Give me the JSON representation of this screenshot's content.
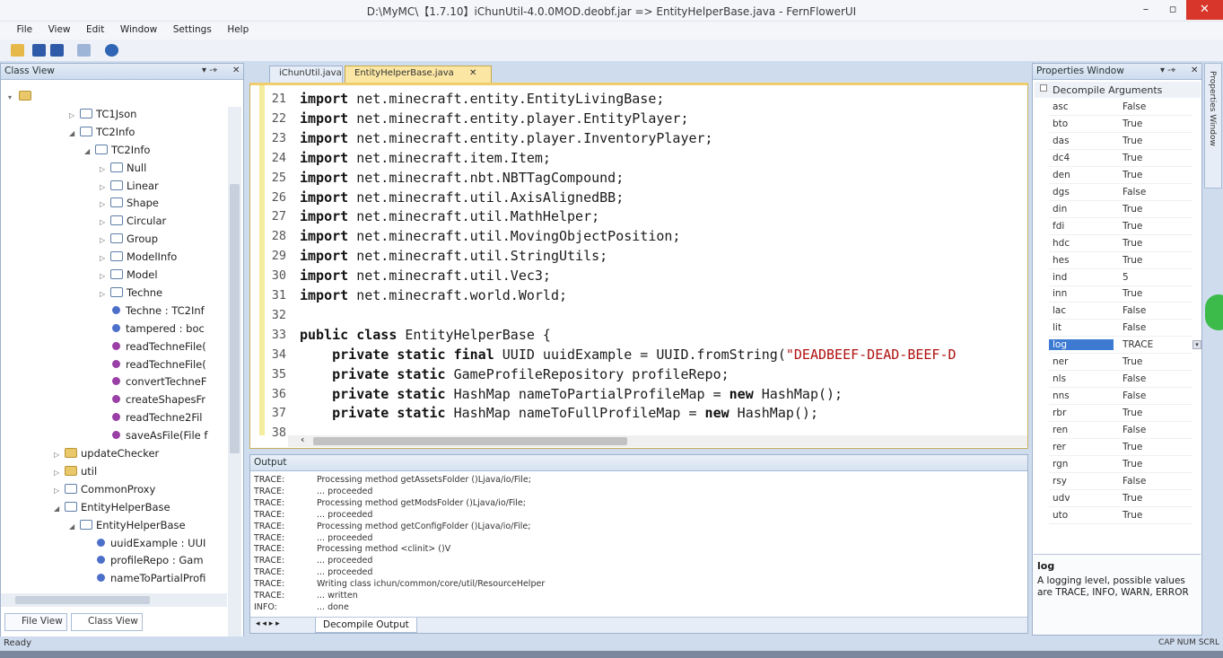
{
  "window": {
    "title": "D:\\MyMC\\【1.7.10】iChunUtil-4.0.0MOD.deobf.jar => EntityHelperBase.java - FernFlowerUI",
    "minimize": "–",
    "maximize": "▫",
    "close": "✕"
  },
  "menu": [
    "File",
    "View",
    "Edit",
    "Window",
    "Settings",
    "Help"
  ],
  "class_view": {
    "title": "Class View",
    "pin": "▾ ‑⌖",
    "close": "✕",
    "tree": [
      {
        "label": "",
        "kind": "pkg",
        "depth": 0,
        "expander": "▾"
      },
      {
        "label": "TC1Json",
        "kind": "cls",
        "depth": 4,
        "expander": "▷"
      },
      {
        "label": "TC2Info",
        "kind": "cls",
        "depth": 4,
        "expander": "◢"
      },
      {
        "label": "TC2Info",
        "kind": "cls",
        "depth": 5,
        "expander": "◢"
      },
      {
        "label": "Null",
        "kind": "cls",
        "depth": 6,
        "expander": "▷"
      },
      {
        "label": "Linear",
        "kind": "cls",
        "depth": 6,
        "expander": "▷"
      },
      {
        "label": "Shape",
        "kind": "cls",
        "depth": 6,
        "expander": "▷"
      },
      {
        "label": "Circular",
        "kind": "cls",
        "depth": 6,
        "expander": "▷"
      },
      {
        "label": "Group",
        "kind": "cls",
        "depth": 6,
        "expander": "▷"
      },
      {
        "label": "ModelInfo",
        "kind": "cls",
        "depth": 6,
        "expander": "▷"
      },
      {
        "label": "Model",
        "kind": "cls",
        "depth": 6,
        "expander": "▷"
      },
      {
        "label": "Techne",
        "kind": "cls",
        "depth": 6,
        "expander": "▷"
      },
      {
        "label": "Techne : TC2Inf",
        "kind": "fld",
        "depth": 6,
        "expander": ""
      },
      {
        "label": "tampered : boc",
        "kind": "fld",
        "depth": 6,
        "expander": ""
      },
      {
        "label": "readTechneFile(",
        "kind": "mth",
        "depth": 6,
        "expander": ""
      },
      {
        "label": "readTechneFile(",
        "kind": "mth",
        "depth": 6,
        "expander": ""
      },
      {
        "label": "convertTechneF",
        "kind": "mth",
        "depth": 6,
        "expander": ""
      },
      {
        "label": "createShapesFr",
        "kind": "mth",
        "depth": 6,
        "expander": ""
      },
      {
        "label": "readTechne2Fil",
        "kind": "mth",
        "depth": 6,
        "expander": ""
      },
      {
        "label": "saveAsFile(File f",
        "kind": "mth",
        "depth": 6,
        "expander": ""
      },
      {
        "label": "updateChecker",
        "kind": "pkg",
        "depth": 3,
        "expander": "▷"
      },
      {
        "label": "util",
        "kind": "pkg",
        "depth": 3,
        "expander": "▷"
      },
      {
        "label": "CommonProxy",
        "kind": "cls",
        "depth": 3,
        "expander": "▷"
      },
      {
        "label": "EntityHelperBase",
        "kind": "cls",
        "depth": 3,
        "expander": "◢"
      },
      {
        "label": "EntityHelperBase",
        "kind": "cls",
        "depth": 4,
        "expander": "◢"
      },
      {
        "label": "uuidExample : UUI",
        "kind": "fld",
        "depth": 5,
        "expander": ""
      },
      {
        "label": "profileRepo : Gam",
        "kind": "fld",
        "depth": 5,
        "expander": ""
      },
      {
        "label": "nameToPartialProfi",
        "kind": "fld",
        "depth": 5,
        "expander": ""
      }
    ],
    "tab_file_view": "File View",
    "tab_class_view": "Class View"
  },
  "editor": {
    "tabs": [
      {
        "label": "iChunUtil.java",
        "active": false
      },
      {
        "label": "EntityHelperBase.java",
        "active": true
      }
    ],
    "tab_close": "✕",
    "scroll_left": "‹",
    "lines": [
      {
        "n": "21",
        "kw": "import",
        "rest": " net.minecraft.entity.EntityLivingBase;",
        "kw2": "",
        "rest2": ""
      },
      {
        "n": "22",
        "kw": "import",
        "rest": " net.minecraft.entity.player.EntityPlayer;",
        "kw2": "",
        "rest2": ""
      },
      {
        "n": "23",
        "kw": "import",
        "rest": " net.minecraft.entity.player.InventoryPlayer;",
        "kw2": "",
        "rest2": ""
      },
      {
        "n": "24",
        "kw": "import",
        "rest": " net.minecraft.item.Item;",
        "kw2": "",
        "rest2": ""
      },
      {
        "n": "25",
        "kw": "import",
        "rest": " net.minecraft.nbt.NBTTagCompound;",
        "kw2": "",
        "rest2": ""
      },
      {
        "n": "26",
        "kw": "import",
        "rest": " net.minecraft.util.AxisAlignedBB;",
        "kw2": "",
        "rest2": ""
      },
      {
        "n": "27",
        "kw": "import",
        "rest": " net.minecraft.util.MathHelper;",
        "kw2": "",
        "rest2": ""
      },
      {
        "n": "28",
        "kw": "import",
        "rest": " net.minecraft.util.MovingObjectPosition;",
        "kw2": "",
        "rest2": ""
      },
      {
        "n": "29",
        "kw": "import",
        "rest": " net.minecraft.util.StringUtils;",
        "kw2": "",
        "rest2": ""
      },
      {
        "n": "30",
        "kw": "import",
        "rest": " net.minecraft.util.Vec3;",
        "kw2": "",
        "rest2": ""
      },
      {
        "n": "31",
        "kw": "import",
        "rest": " net.minecraft.world.World;",
        "kw2": "",
        "rest2": ""
      },
      {
        "n": "32",
        "kw": "",
        "rest": "",
        "kw2": "",
        "rest2": ""
      },
      {
        "n": "33",
        "kw": "public class",
        "rest": " EntityHelperBase {",
        "kw2": "",
        "rest2": ""
      },
      {
        "n": "34",
        "kw": "    private static final",
        "rest": " UUID uuidExample = UUID.fromString(",
        "kw2": "",
        "rest2": "\"DEADBEEF-DEAD-BEEF-D"
      },
      {
        "n": "35",
        "kw": "    private static",
        "rest": " GameProfileRepository profileRepo;",
        "kw2": "",
        "rest2": ""
      },
      {
        "n": "36",
        "kw": "    private static",
        "rest": " HashMap nameToPartialProfileMap = ",
        "kw2": "new",
        "rest2": " HashMap();"
      },
      {
        "n": "37",
        "kw": "    private static",
        "rest": " HashMap nameToFullProfileMap = ",
        "kw2": "new",
        "rest2": " HashMap();"
      },
      {
        "n": "38",
        "kw": "",
        "rest": "",
        "kw2": "",
        "rest2": ""
      }
    ]
  },
  "output": {
    "title": "Output",
    "rows": [
      {
        "level": "TRACE:",
        "msg": "Processing method getAssetsFolder ()Ljava/io/File;"
      },
      {
        "level": "TRACE:",
        "msg": "... proceeded"
      },
      {
        "level": "TRACE:",
        "msg": "Processing method getModsFolder ()Ljava/io/File;"
      },
      {
        "level": "TRACE:",
        "msg": "... proceeded"
      },
      {
        "level": "TRACE:",
        "msg": "Processing method getConfigFolder ()Ljava/io/File;"
      },
      {
        "level": "TRACE:",
        "msg": "... proceeded"
      },
      {
        "level": "TRACE:",
        "msg": "Processing method <clinit> ()V"
      },
      {
        "level": "TRACE:",
        "msg": "... proceeded"
      },
      {
        "level": "TRACE:",
        "msg": "... proceeded"
      },
      {
        "level": "TRACE:",
        "msg": "Writing class ichun/common/core/util/ResourceHelper"
      },
      {
        "level": "TRACE:",
        "msg": "... written"
      },
      {
        "level": "INFO:",
        "msg": "... done"
      }
    ],
    "tab_label": "Decompile Output",
    "nav": "◂ ◂ ▸ ▸"
  },
  "properties": {
    "title": "Properties Window",
    "group": "Decompile Arguments",
    "rows": [
      {
        "key": "asc",
        "value": "False"
      },
      {
        "key": "bto",
        "value": "True"
      },
      {
        "key": "das",
        "value": "True"
      },
      {
        "key": "dc4",
        "value": "True"
      },
      {
        "key": "den",
        "value": "True"
      },
      {
        "key": "dgs",
        "value": "False"
      },
      {
        "key": "din",
        "value": "True"
      },
      {
        "key": "fdi",
        "value": "True"
      },
      {
        "key": "hdc",
        "value": "True"
      },
      {
        "key": "hes",
        "value": "True"
      },
      {
        "key": "ind",
        "value": "5"
      },
      {
        "key": "inn",
        "value": "True"
      },
      {
        "key": "lac",
        "value": "False"
      },
      {
        "key": "lit",
        "value": "False"
      },
      {
        "key": "log",
        "value": "TRACE"
      },
      {
        "key": "ner",
        "value": "True"
      },
      {
        "key": "nls",
        "value": "False"
      },
      {
        "key": "nns",
        "value": "False"
      },
      {
        "key": "rbr",
        "value": "True"
      },
      {
        "key": "ren",
        "value": "False"
      },
      {
        "key": "rer",
        "value": "True"
      },
      {
        "key": "rgn",
        "value": "True"
      },
      {
        "key": "rsy",
        "value": "False"
      },
      {
        "key": "udv",
        "value": "True"
      },
      {
        "key": "uto",
        "value": "True"
      }
    ],
    "selected": "log",
    "desc_title": "log",
    "desc_text": "A logging level, possible values are TRACE, INFO, WARN, ERROR",
    "side_tab": "Properties Window"
  },
  "status": {
    "left": "Ready",
    "right": "CAP  NUM  SCRL"
  }
}
